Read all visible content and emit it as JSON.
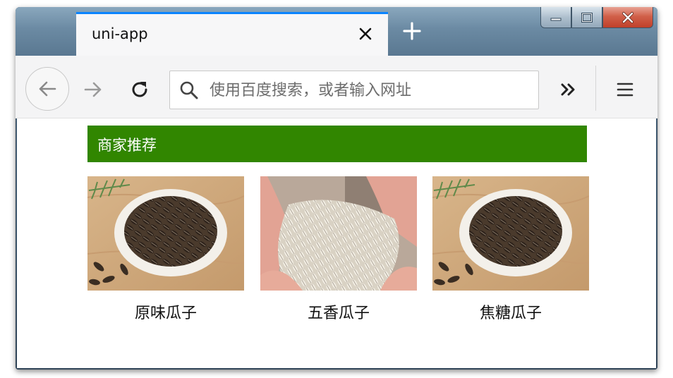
{
  "browser": {
    "tab_title": "uni-app",
    "search_placeholder": "使用百度搜索，或者输入网址"
  },
  "page": {
    "section_title": "商家推荐",
    "products": [
      {
        "name": "原味瓜子",
        "image": "sunflower-seeds-bowl"
      },
      {
        "name": "五香瓜子",
        "image": "white-seeds-hands"
      },
      {
        "name": "焦糖瓜子",
        "image": "sunflower-seeds-bowl"
      }
    ]
  },
  "colors": {
    "section_header_bg": "#318600",
    "tab_accent": "#0a84ff"
  }
}
